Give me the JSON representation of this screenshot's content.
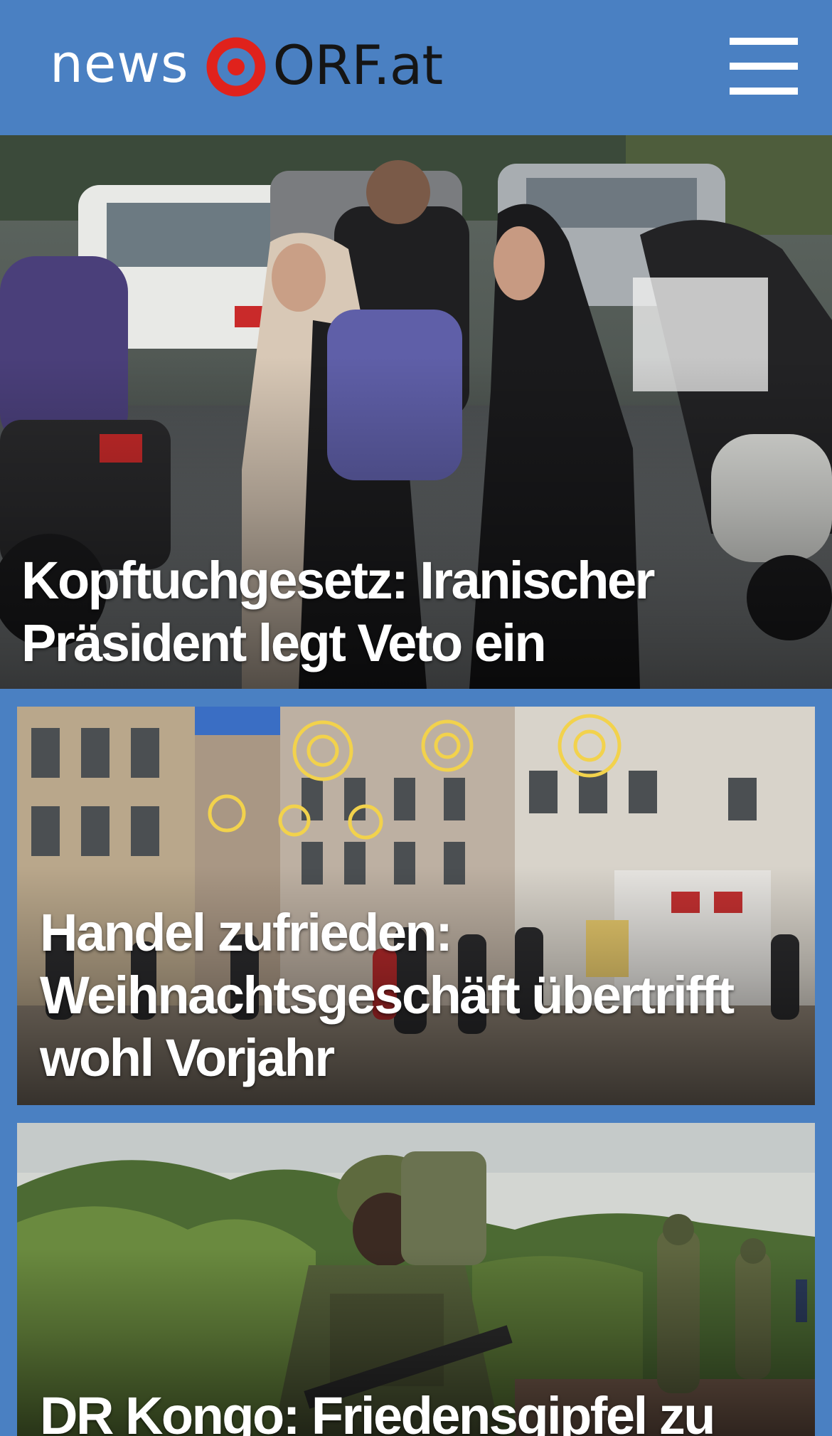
{
  "header": {
    "logo_news": "news",
    "logo_orf": "ORF.at",
    "brand_red": "#e0221c",
    "bar_color": "#4a80c2"
  },
  "icons": {
    "logo_mark": "orf-eye-icon",
    "menu": "hamburger-menu-icon"
  },
  "stories": [
    {
      "headline": "Kopftuchgesetz: Iranischer Präsident legt Veto ein"
    },
    {
      "headline": "Handel zufrieden: Weihnachtsgeschäft übertrifft wohl Vorjahr"
    },
    {
      "headline": "DR Kongo: Friedensgipfel zu"
    }
  ]
}
